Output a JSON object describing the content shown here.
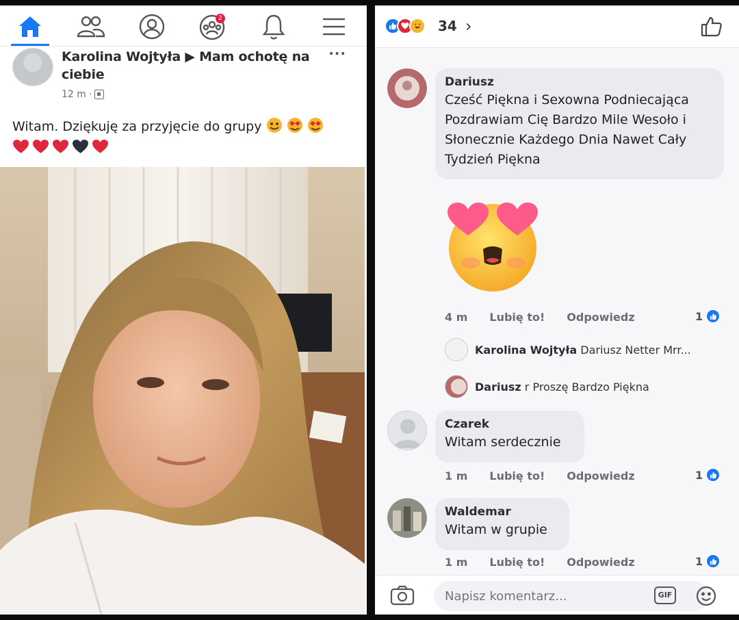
{
  "left_panel": {
    "nav": {
      "items": [
        "home-icon",
        "friends-icon",
        "profile-icon",
        "groups-icon",
        "notifications-icon",
        "menu-icon"
      ],
      "groups_badge": "2",
      "active_color": "#1877f2"
    },
    "post": {
      "author_line": "Karolina Wojtyła ▶ Mam ochotę na ciebie",
      "time": "12 m",
      "more": "···",
      "text": "Witam. Dziękuję za przyjęcie do grupy"
    }
  },
  "right_panel": {
    "reactions": {
      "count": "34",
      "chevron": "›"
    },
    "comments": [
      {
        "author": "Dariusz",
        "text": "Cześć Piękna i Sexowna Podniecająca Pozdrawiam Cię Bardzo Mile Wesoło i Słonecznie Każdego Dnia Nawet Cały Tydzień Piękna",
        "time": "4 m",
        "like": "Lubię to!",
        "reply": "Odpowiedz",
        "likes": "1",
        "replies": [
          {
            "author": "Karolina Wojtyła",
            "text": "Dariusz Netter Mrr..."
          },
          {
            "author": "Dariusz",
            "text": "r Proszę Bardzo Piękna"
          }
        ]
      },
      {
        "author": "Czarek",
        "text": "Witam serdecznie",
        "time": "1 m",
        "like": "Lubię to!",
        "reply": "Odpowiedz",
        "likes": "1"
      },
      {
        "author": "Waldemar",
        "text": "Witam w grupie",
        "time": "1 m",
        "like": "Lubię to!",
        "reply": "Odpowiedz",
        "likes": "1"
      }
    ],
    "composer": {
      "placeholder": "Napisz komentarz...",
      "gif_label": "GIF"
    }
  },
  "colors": {
    "fb_blue": "#1877f2",
    "bubble": "#ebebef",
    "heart_red": "#e0283c"
  }
}
